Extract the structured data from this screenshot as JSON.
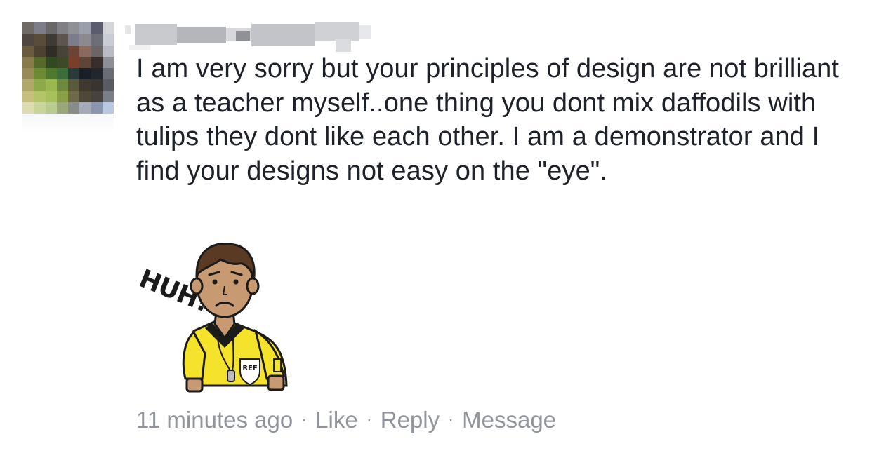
{
  "comment": {
    "author": {
      "name_visible": false,
      "avatar_pixelated": true
    },
    "text": "I am very sorry but your principles of design are not brilliant as a teacher myself..one thing you dont mix daffodils with tulips they dont like each other. I am a demonstrator and I find your designs not easy on the \"eye\".",
    "sticker": {
      "icon": "confused-referee-sticker",
      "caption": "HUH?",
      "badge": "REF"
    },
    "meta": {
      "timestamp": "11 minutes ago",
      "separator": "·",
      "like_label": "Like",
      "reply_label": "Reply",
      "message_label": "Message"
    }
  },
  "colors": {
    "text": "#1d2129",
    "meta": "#90949c",
    "shirt": "#f5e22a",
    "skin": "#c89a72",
    "hair": "#5a3a22"
  }
}
